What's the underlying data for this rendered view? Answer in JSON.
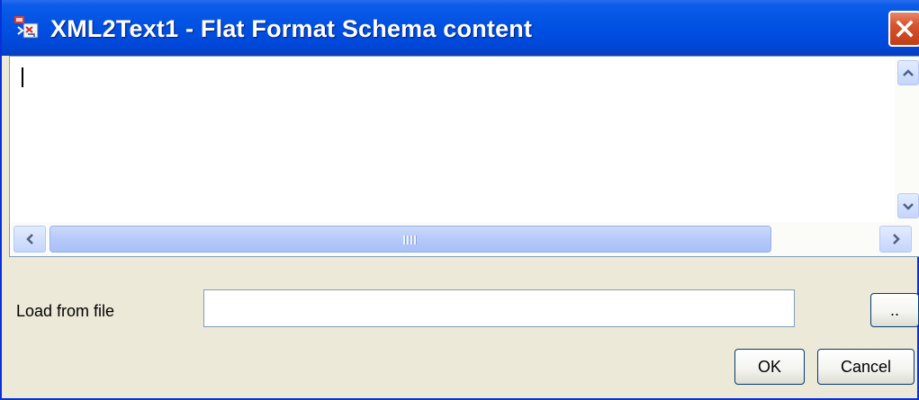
{
  "window": {
    "title": "XML2Text1 - Flat Format Schema content",
    "app_icon": "xml2text-icon",
    "close_icon": "close-icon"
  },
  "editor": {
    "content": "",
    "vertical_scroll": {
      "up_icon": "chevron-up-icon",
      "down_icon": "chevron-down-icon"
    },
    "horizontal_scroll": {
      "left_icon": "chevron-left-icon",
      "right_icon": "chevron-right-icon",
      "thumb_grip": "grip-icon"
    }
  },
  "load_from_file": {
    "label": "Load from file",
    "value": "",
    "browse_label": ".."
  },
  "buttons": {
    "ok": "OK",
    "cancel": "Cancel"
  },
  "colors": {
    "titlebar": "#0050e2",
    "close_button": "#d5532d",
    "dialog_background": "#ece9d8",
    "scroll_button": "#c4d5fb"
  }
}
